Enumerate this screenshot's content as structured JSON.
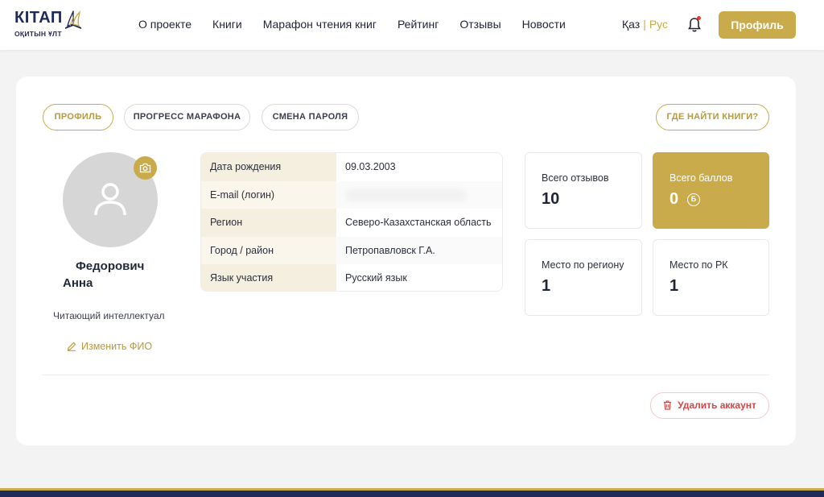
{
  "header": {
    "logo_title": "КІТАП",
    "logo_sub": "ОҚИТЫН ҰЛТ",
    "nav": [
      "О проекте",
      "Книги",
      "Марафон чтения книг",
      "Рейтинг",
      "Отзывы",
      "Новости"
    ],
    "lang_kz": "Қаз",
    "lang_sep": "|",
    "lang_ru": "Рус",
    "profile_label": "Профиль"
  },
  "tabs": {
    "profile": "ПРОФИЛЬ",
    "marathon": "ПРОГРЕСС МАРАФОНА",
    "password": "СМЕНА ПАРОЛЯ",
    "find_books": "ГДЕ НАЙТИ КНИГИ?"
  },
  "user": {
    "surname": "Федорович",
    "firstname": "Анна",
    "status": "Читающий интеллектуал",
    "edit_name": "Изменить ФИО"
  },
  "info": [
    {
      "label": "Дата рождения",
      "value": "09.03.2003"
    },
    {
      "label": "E-mail (логин)",
      "value": ""
    },
    {
      "label": "Регион",
      "value": "Северо-Казахстанская область"
    },
    {
      "label": "Город / район",
      "value": "Петропавловск Г.А."
    },
    {
      "label": "Язык участия",
      "value": "Русский язык"
    }
  ],
  "stats": {
    "reviews_label": "Всего отзывов",
    "reviews_value": "10",
    "points_label": "Всего баллов",
    "points_value": "0",
    "coin_symbol": "Б",
    "region_label": "Место по региону",
    "region_value": "1",
    "rk_label": "Место по РК",
    "rk_value": "1"
  },
  "delete_label": "Удалить аккаунт",
  "colors": {
    "accent": "#c9ab4c",
    "brand_dark": "#1e2a5a",
    "danger": "#d64545"
  }
}
